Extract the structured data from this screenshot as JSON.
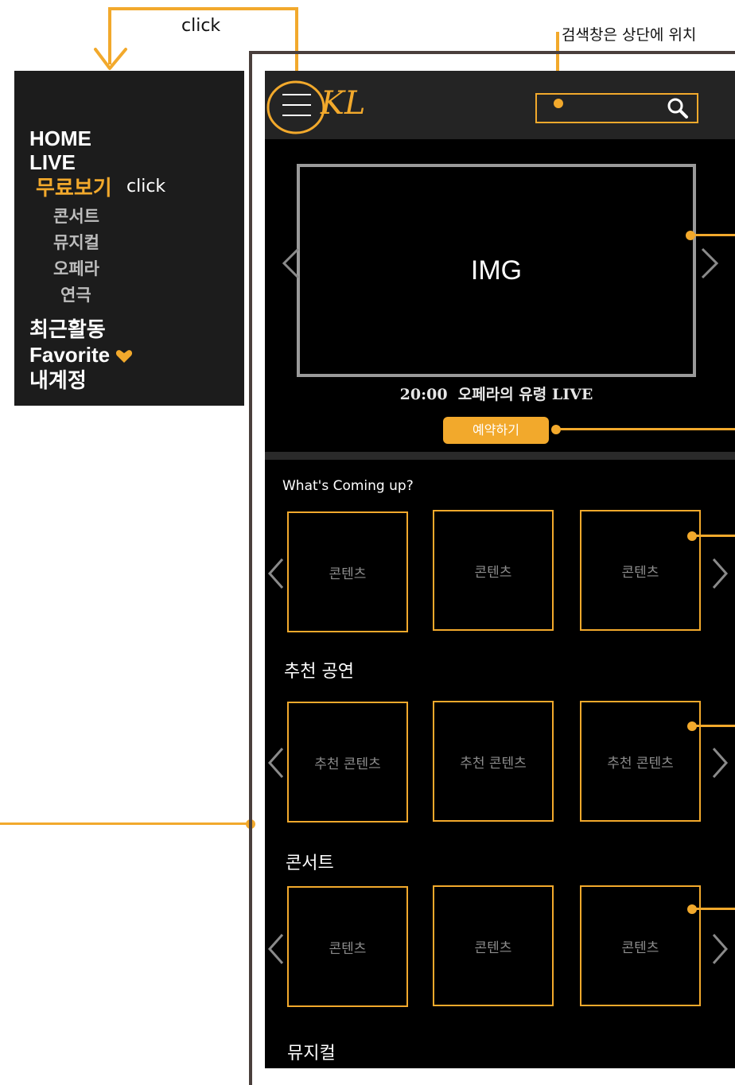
{
  "annotations": {
    "click_top": "click",
    "click_menu": "click",
    "search_note": "검색창은 상단에 위치"
  },
  "side_menu": {
    "home": "HOME",
    "live": "LIVE",
    "free": "무료보기",
    "sub_items": [
      "콘서트",
      "뮤지컬",
      "오페라",
      "연극"
    ],
    "recent": "최근활동",
    "favorite": "Favorite",
    "account": "내계정"
  },
  "header": {
    "logo": "KL",
    "search_placeholder": ""
  },
  "hero": {
    "image_label": "IMG",
    "caption": "20:00  오페라의 유령 LIVE",
    "reserve_button": "예약하기"
  },
  "sections": [
    {
      "title": "What's Coming up?",
      "items": [
        "콘텐츠",
        "콘텐츠",
        "콘텐츠"
      ]
    },
    {
      "title": "추천 공연",
      "items": [
        "추천 콘텐츠",
        "추천 콘텐츠",
        "추천 콘텐츠"
      ]
    },
    {
      "title": "콘서트",
      "items": [
        "콘텐츠",
        "콘텐츠",
        "콘텐츠"
      ]
    },
    {
      "title": "뮤지컬",
      "items": []
    }
  ],
  "colors": {
    "accent": "#f2a92c",
    "app_bg": "#000000",
    "header_bg": "#242424",
    "menu_bg": "#1c1c1c"
  },
  "icons": {
    "menu": "hamburger-icon",
    "search": "search-icon",
    "heart": "heart-icon",
    "prev": "chevron-left-icon",
    "next": "chevron-right-icon"
  }
}
